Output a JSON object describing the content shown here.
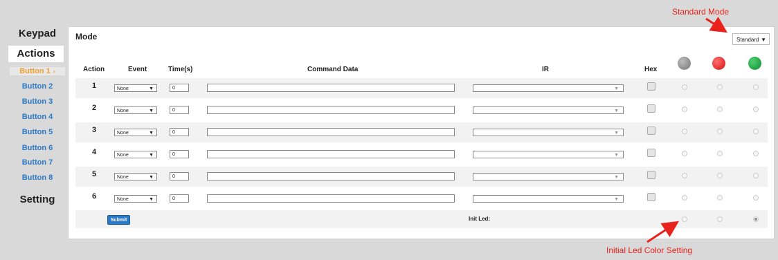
{
  "sidebar": {
    "keypad": "Keypad",
    "actions": "Actions",
    "buttons": [
      "Button 1",
      "Button 2",
      "Button 3",
      "Button 4",
      "Button 5",
      "Button 6",
      "Button 7",
      "Button 8"
    ],
    "active_button": "Button 1",
    "setting": "Setting"
  },
  "panel": {
    "title": "Mode",
    "mode_select_value": "Standard",
    "columns": {
      "action": "Action",
      "event": "Event",
      "time": "Time(s)",
      "command": "Command Data",
      "ir": "IR",
      "hex": "Hex"
    },
    "led_colors": [
      "#999999",
      "#e31c1c",
      "#1f9e3f"
    ],
    "rows": [
      {
        "num": "1",
        "event": "None",
        "time": "0"
      },
      {
        "num": "2",
        "event": "None",
        "time": "0"
      },
      {
        "num": "3",
        "event": "None",
        "time": "0"
      },
      {
        "num": "4",
        "event": "None",
        "time": "0"
      },
      {
        "num": "5",
        "event": "None",
        "time": "0"
      },
      {
        "num": "6",
        "event": "None",
        "time": "0"
      }
    ],
    "submit_label": "Submit",
    "init_led_label": "Init Led:",
    "init_led_selected": "green"
  },
  "annotations": {
    "standard_mode": "Standard Mode",
    "initial_led": "Initial Led Color Setting"
  },
  "colors": {
    "accent": "#2a78c8",
    "active": "#f0a030",
    "annotation": "#e8221c"
  }
}
